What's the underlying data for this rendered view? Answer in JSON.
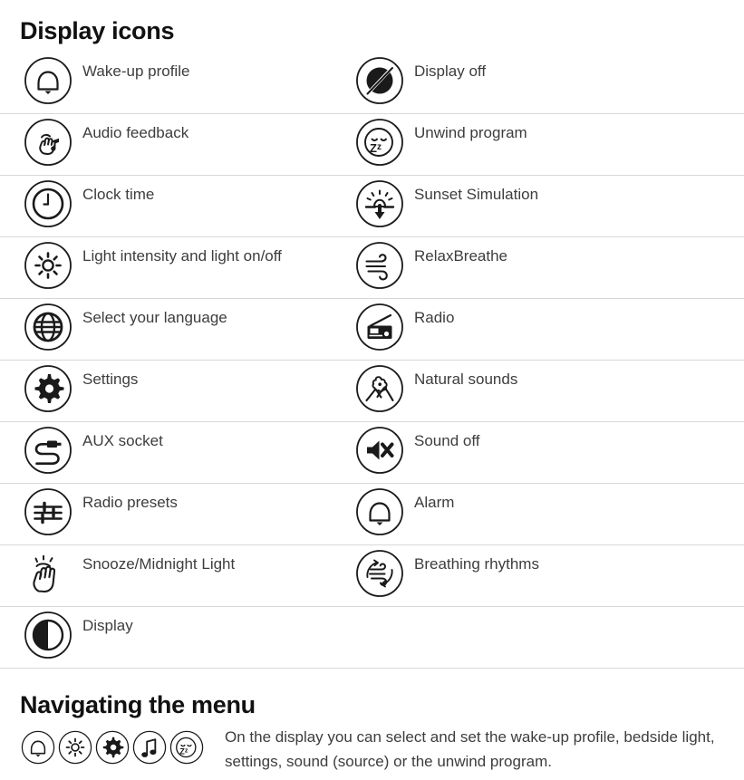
{
  "sections": {
    "display_icons": {
      "title": "Display icons",
      "rows": [
        {
          "left": {
            "icon": "bell-icon",
            "label": "Wake-up profile"
          },
          "right": {
            "icon": "display-off-icon",
            "label": "Display off"
          }
        },
        {
          "left": {
            "icon": "audio-feedback-icon",
            "label": "Audio feedback"
          },
          "right": {
            "icon": "unwind-program-icon",
            "label": "Unwind program"
          }
        },
        {
          "left": {
            "icon": "clock-icon",
            "label": "Clock time"
          },
          "right": {
            "icon": "sunset-simulation-icon",
            "label": "Sunset Simulation"
          }
        },
        {
          "left": {
            "icon": "light-intensity-icon",
            "label": "Light intensity and light on/off"
          },
          "right": {
            "icon": "relax-breathe-icon",
            "label": "RelaxBreathe"
          }
        },
        {
          "left": {
            "icon": "globe-icon",
            "label": "Select your language"
          },
          "right": {
            "icon": "radio-icon",
            "label": "Radio"
          }
        },
        {
          "left": {
            "icon": "gear-icon",
            "label": "Settings"
          },
          "right": {
            "icon": "natural-sounds-icon",
            "label": "Natural sounds"
          }
        },
        {
          "left": {
            "icon": "aux-socket-icon",
            "label": "AUX socket"
          },
          "right": {
            "icon": "sound-off-icon",
            "label": "Sound off"
          }
        },
        {
          "left": {
            "icon": "radio-presets-icon",
            "label": "Radio presets"
          },
          "right": {
            "icon": "alarm-bell-icon",
            "label": "Alarm"
          }
        },
        {
          "left": {
            "icon": "snooze-hand-icon",
            "label": "Snooze/Midnight Light"
          },
          "right": {
            "icon": "breathing-rhythms-icon",
            "label": "Breathing rhythms"
          }
        },
        {
          "left": {
            "icon": "display-contrast-icon",
            "label": "Display"
          },
          "right": {
            "icon": "",
            "label": ""
          }
        }
      ]
    },
    "navigating": {
      "title": "Navigating the menu",
      "icons": [
        "bell-icon",
        "light-intensity-icon",
        "gear-icon",
        "music-note-icon",
        "unwind-program-icon"
      ],
      "body": "On the display you can select and set the wake-up profile, bedside light, settings, sound (source) or the unwind program."
    }
  },
  "colors": {
    "text": "#3d3d3d",
    "heading": "#111111",
    "divider": "#d8d8d8",
    "icon": "#1a1a1a",
    "background": "#ffffff"
  }
}
